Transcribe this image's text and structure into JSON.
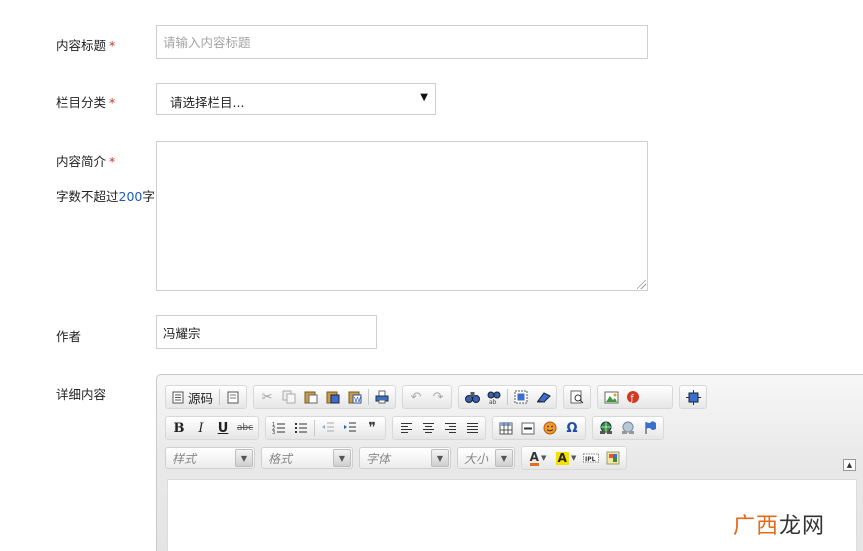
{
  "form": {
    "title_label": "内容标题",
    "title_placeholder": "请输入内容标题",
    "category_label": "栏目分类",
    "category_selected": "请选择栏目...",
    "desc_label": "内容简介",
    "desc_hint_prefix": "字数不超过",
    "desc_hint_number": "200",
    "desc_hint_suffix": "字",
    "author_label": "作者",
    "author_value": "冯耀宗",
    "detail_label": "详细内容",
    "required_mark": "*"
  },
  "editor": {
    "source_label": "源码",
    "style_combo": "样式",
    "format_combo": "格式",
    "font_combo": "字体",
    "size_combo": "大小",
    "collapse_glyph": "▲",
    "icons": {
      "bold": "B",
      "italic": "I",
      "underline": "U",
      "strike": "abc",
      "quote": "❞",
      "omega": "Ω",
      "text_color": "A",
      "bg_color": "A"
    }
  },
  "watermark": {
    "brand": "广西",
    "rest": "龙网"
  },
  "colors": {
    "required": "#c0392b",
    "hint_number": "#1a5bb8",
    "watermark": "#e46a1c"
  }
}
